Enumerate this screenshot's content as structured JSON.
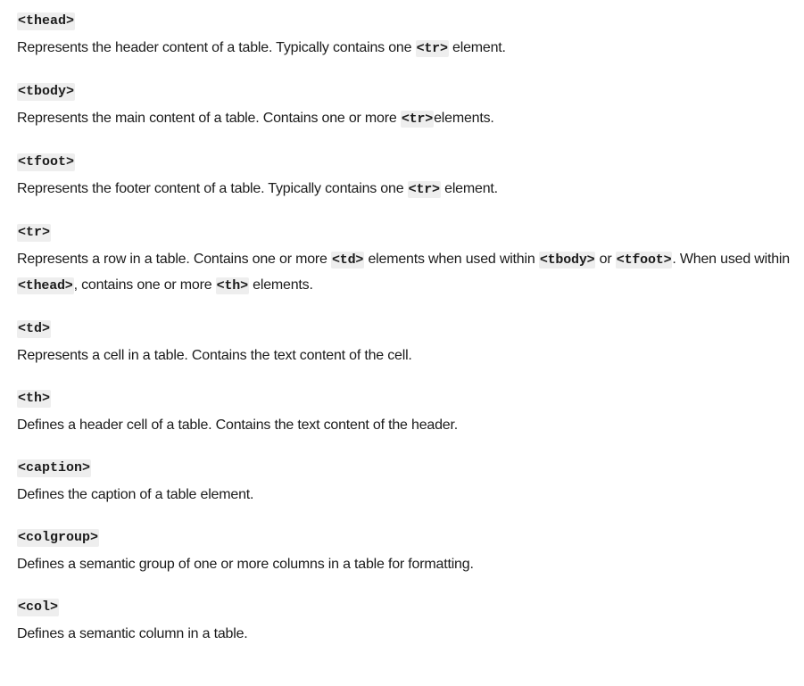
{
  "entries": [
    {
      "term": "<thead>",
      "desc": [
        "Represents the header content of a table. Typically contains one ",
        "<tr>",
        " element."
      ]
    },
    {
      "term": "<tbody>",
      "desc": [
        "Represents the main content of a table. Contains one or more ",
        "<tr>",
        "elements."
      ]
    },
    {
      "term": "<tfoot>",
      "desc": [
        "Represents the footer content of a table. Typically contains one ",
        "<tr>",
        " element."
      ]
    },
    {
      "term": "<tr>",
      "desc": [
        "Represents a row in a table. Contains one or more ",
        "<td>",
        " elements when used within ",
        "<tbody>",
        " or ",
        "<tfoot>",
        ". When used within ",
        "<thead>",
        ", contains one or more ",
        "<th>",
        " elements."
      ]
    },
    {
      "term": "<td>",
      "desc": [
        "Represents a cell in a table. Contains the text content of the cell."
      ]
    },
    {
      "term": "<th>",
      "desc": [
        "Defines a header cell of a table. Contains the text content of the header."
      ]
    },
    {
      "term": "<caption>",
      "desc": [
        "Defines the caption of a table element."
      ]
    },
    {
      "term": "<colgroup>",
      "desc": [
        "Defines a semantic group of one or more columns in a table for formatting."
      ]
    },
    {
      "term": "<col>",
      "desc": [
        "Defines a semantic column in a table."
      ]
    }
  ]
}
